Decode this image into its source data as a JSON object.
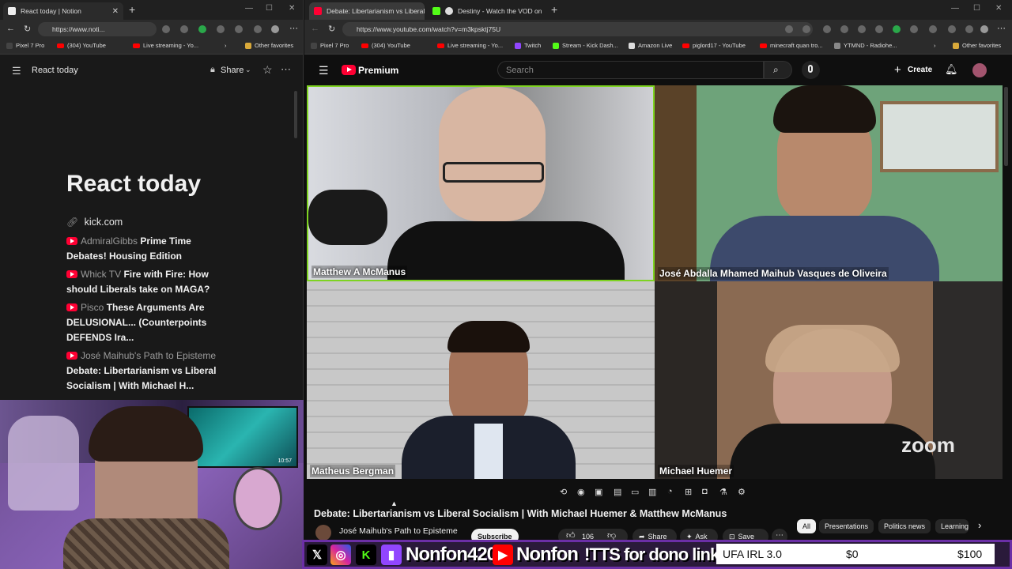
{
  "left_browser": {
    "tab_title": "React today | Notion",
    "url": "https://www.noti...",
    "bookmarks": [
      "Pixel 7 Pro",
      "(304) YouTube",
      "Live streaming - Yo...",
      "Other favorites"
    ]
  },
  "notion": {
    "breadcrumb_title": "React today",
    "share_label": "Share",
    "page_title": "React today",
    "link_text": "kick.com",
    "entries": [
      {
        "channel": "AdmiralGibbs",
        "title": "Prime Time Debates! Housing Edition"
      },
      {
        "channel": "Whick TV",
        "title": "Fire with Fire: How should Liberals take on MAGA?"
      },
      {
        "channel": "Pisco",
        "title": "These Arguments Are DELUSIONAL... (Counterpoints DEFENDS Ira..."
      },
      {
        "channel": "José Maihub's Path to Episteme",
        "title": "Debate: Libertarianism vs Liberal Socialism | With Michael H..."
      }
    ]
  },
  "webcam": {
    "clock": "10:57"
  },
  "right_browser": {
    "tabs": [
      "Debate: Libertarianism vs Liberal S",
      "Destiny - Watch the VOD on"
    ],
    "url": "https://www.youtube.com/watch?v=m3kpsktj75U",
    "bookmarks": [
      "Pixel 7 Pro",
      "(304) YouTube",
      "Live streaming - Yo...",
      "Twitch",
      "Stream - Kick Dash...",
      "Amazon Live",
      "piglord17 - YouTube",
      "minecraft quan tro...",
      "YTMND - Radiohe...",
      "Other favorites"
    ]
  },
  "youtube": {
    "logo_text": "Premium",
    "search_placeholder": "Search",
    "create_label": "Create",
    "participants": [
      "Matthew A McManus",
      "José Abdalla Mhamed Maihub Vasques de Oliveira",
      "Matheus Bergman",
      "Michael Huemer"
    ],
    "watermark": "zoom",
    "video_title": "Debate: Libertarianism vs Liberal Socialism | With Michael Huemer & Matthew McManus",
    "channel_name": "José Maihub's Path to Episteme",
    "subscribe_label": "Subscribe",
    "likes": "106",
    "share_label": "Share",
    "ask_label": "Ask",
    "save_label": "Save",
    "chips": [
      "All",
      "Presentations",
      "Politics news",
      "Learning"
    ]
  },
  "overlay": {
    "handle1": "Nonfon420",
    "handle2": "Nonfon",
    "tts_text": "!TTS for dono link",
    "goal_label": "UFA IRL 3.0",
    "goal_current": "$0",
    "goal_target": "$100"
  },
  "colors": {
    "youtube_red": "#ff0033",
    "speaker_border": "#7ed321",
    "overlay_purple": "#6b2fa6"
  }
}
